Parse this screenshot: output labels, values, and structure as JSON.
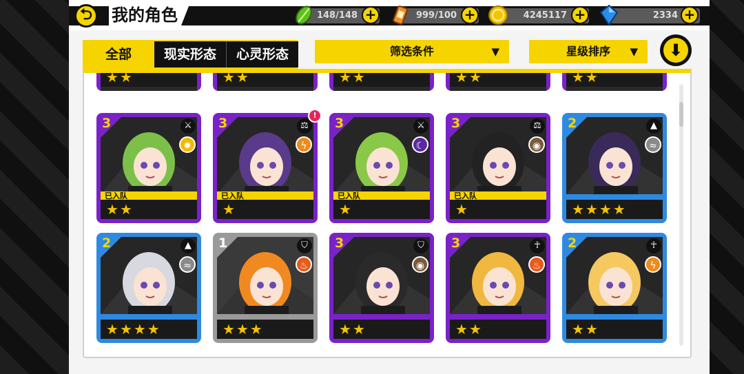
{
  "header": {
    "back_icon": "arrow-left-icon",
    "title": "我的角色",
    "resources": [
      {
        "name": "stamina",
        "icon": "leaf-icon",
        "value": "148/148",
        "color": "#5bc21a"
      },
      {
        "name": "battery",
        "icon": "battery-icon",
        "value": "999/100",
        "color": "#f0902a"
      },
      {
        "name": "coins",
        "icon": "coin-icon",
        "value": "4245117",
        "color": "#f5c400"
      },
      {
        "name": "gems",
        "icon": "crystal-icon",
        "value": "2334",
        "color": "#2a8ee8"
      }
    ],
    "plus_label": "+"
  },
  "filters": {
    "tabs": [
      "全部",
      "现实形态",
      "心灵形态"
    ],
    "active_tab": "全部",
    "filter_dropdown": "筛选条件",
    "sort_dropdown": "星级排序",
    "dropdown_arrow": "▼",
    "down_button": "⬇"
  },
  "colors": {
    "accent": "#f5d400",
    "purple": "#7a22c9",
    "blue": "#2e8ae0",
    "grey": "#9a9a9a"
  },
  "team_label": "已入队",
  "top_row": [
    {
      "frame": "purple",
      "stars": 2
    },
    {
      "frame": "purple",
      "stars": 2
    },
    {
      "frame": "purple",
      "stars": 2
    },
    {
      "frame": "purple",
      "stars": 2
    },
    {
      "frame": "purple",
      "stars": 2
    }
  ],
  "cards": [
    {
      "rank": "3",
      "frame": "purple",
      "weapon_icon": "sword-icon",
      "element_icon": "light-icon",
      "element_color": "#f5b800",
      "in_team": true,
      "stars": 2,
      "notice": false,
      "hair": "#7cc04a"
    },
    {
      "rank": "3",
      "frame": "purple",
      "weapon_icon": "scales-icon",
      "element_icon": "lightning-icon",
      "element_color": "#f08a1a",
      "in_team": true,
      "stars": 1,
      "notice": true,
      "hair": "#5a3a8a"
    },
    {
      "rank": "3",
      "frame": "purple",
      "weapon_icon": "sword-icon",
      "element_icon": "moon-icon",
      "element_color": "#5a2aa0",
      "in_team": true,
      "stars": 1,
      "notice": false,
      "hair": "#8ac848"
    },
    {
      "rank": "3",
      "frame": "purple",
      "weapon_icon": "scales-icon",
      "element_icon": "earth-icon",
      "element_color": "#7a5a3a",
      "in_team": true,
      "stars": 1,
      "notice": false,
      "hair": "#222222"
    },
    {
      "rank": "2",
      "frame": "blue",
      "weapon_icon": "triforce-icon",
      "element_icon": "wind-icon",
      "element_color": "#8a8a8a",
      "in_team": false,
      "stars": 4,
      "notice": false,
      "hair": "#3a2a5a"
    },
    {
      "rank": "2",
      "frame": "blue",
      "weapon_icon": "triforce-icon",
      "element_icon": "wind-icon",
      "element_color": "#8a8a8a",
      "in_team": false,
      "stars": 4,
      "notice": false,
      "hair": "#d8d8e0"
    },
    {
      "rank": "1",
      "frame": "grey",
      "weapon_icon": "shield-icon",
      "element_icon": "fire-icon",
      "element_color": "#e85a1a",
      "in_team": false,
      "stars": 3,
      "notice": false,
      "hair": "#f08a20"
    },
    {
      "rank": "3",
      "frame": "purple",
      "weapon_icon": "shield-icon",
      "element_icon": "earth-icon",
      "element_color": "#7a5a3a",
      "in_team": false,
      "stars": 2,
      "notice": false,
      "hair": "#2a2a2a"
    },
    {
      "rank": "3",
      "frame": "purple",
      "weapon_icon": "ankh-icon",
      "element_icon": "fire-icon",
      "element_color": "#e85a1a",
      "in_team": false,
      "stars": 2,
      "notice": false,
      "hair": "#f0b840"
    },
    {
      "rank": "2",
      "frame": "blue",
      "weapon_icon": "ankh-icon",
      "element_icon": "lightning-icon",
      "element_color": "#f08a1a",
      "in_team": false,
      "stars": 2,
      "notice": false,
      "hair": "#f5c860"
    }
  ]
}
